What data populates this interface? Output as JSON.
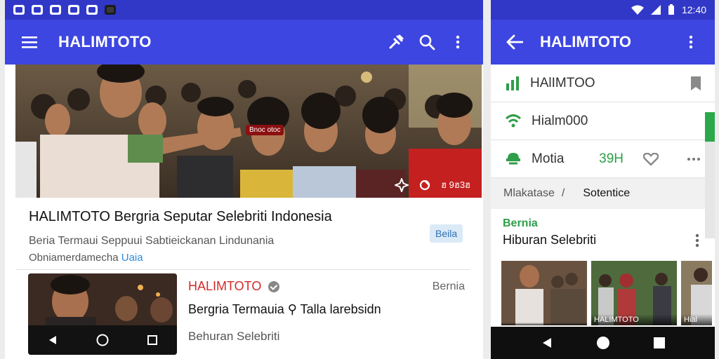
{
  "left": {
    "appbar": {
      "title": "HALIMTOTO"
    },
    "hero": {
      "tag": "Bnoc otoc",
      "meta": "ฮ 9ฮ3ฮ"
    },
    "article": {
      "title": "HALIMTOTO Bergria Seputar Selebriti Indonesia",
      "subtitle": "Beria Termaui Seppuui Sabtieickanan Lindunania",
      "subtitle2_text": "Obniamerdamecha ",
      "subtitle2_link": "Uaia",
      "chip": "Beila"
    },
    "card2": {
      "brand": "HALIMTOTO",
      "category": "Bernia",
      "title": "Bergria Termauia ⚲ Talla larebsidn",
      "subtitle": "Behuran Selebriti"
    }
  },
  "right": {
    "status": {
      "time": "12:40"
    },
    "appbar": {
      "title": "HALIMTOTO"
    },
    "rows": [
      {
        "label": "HAlIMTOO"
      },
      {
        "label": "Hialm000"
      },
      {
        "label": "Motia",
        "extra": "39H"
      }
    ],
    "tabs": {
      "first": "Mlakatase",
      "sep": "/",
      "active": "Sotentice"
    },
    "section": {
      "kicker": "Bernia",
      "heading": "Hiburan Selebriti"
    },
    "gallery": [
      {
        "caption": ""
      },
      {
        "caption": "HALIMTOTO"
      },
      {
        "caption": "Hial"
      }
    ]
  },
  "colors": {
    "primary": "#3d46e0",
    "status": "#3138c8",
    "accent_green": "#2e9e48",
    "brand_red": "#d22a2a"
  }
}
